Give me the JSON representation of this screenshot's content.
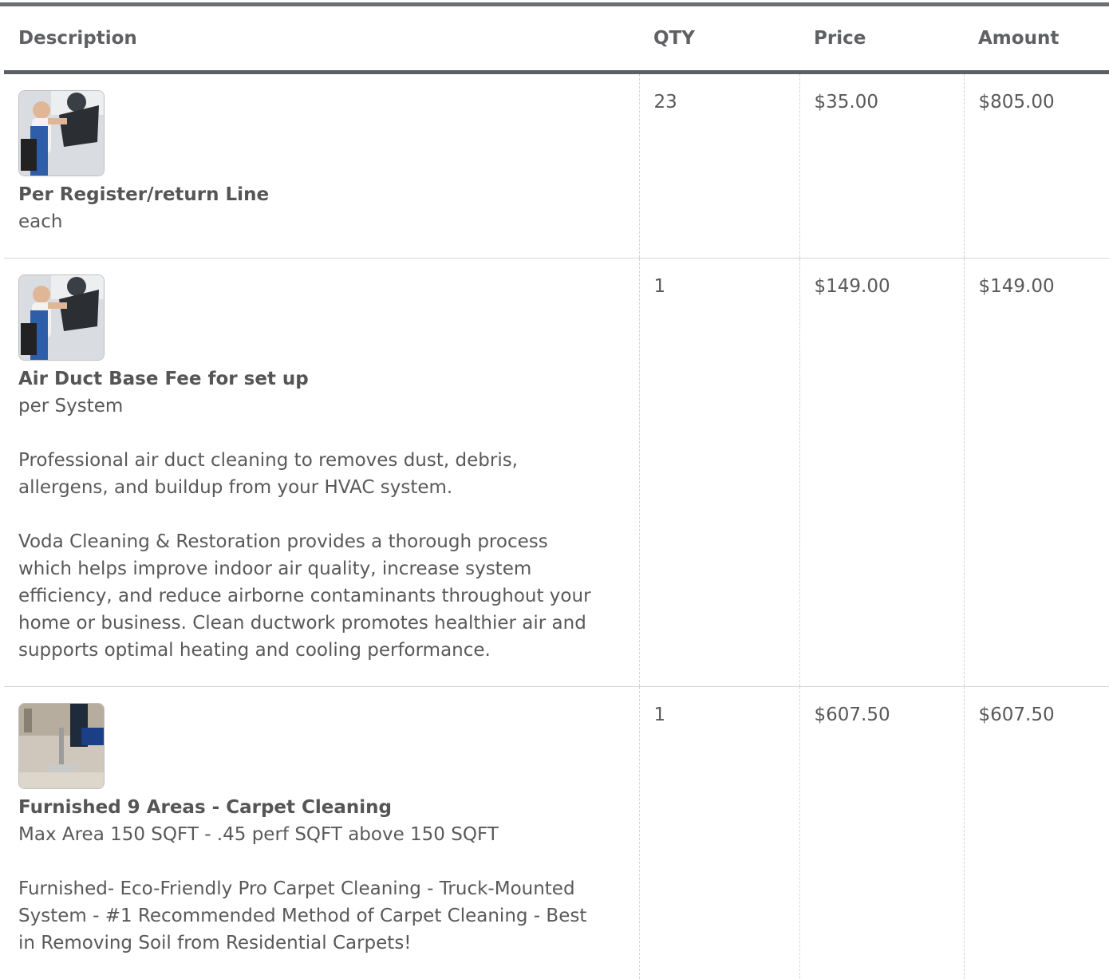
{
  "table": {
    "headers": {
      "description": "Description",
      "qty": "QTY",
      "price": "Price",
      "amount": "Amount"
    },
    "rows": [
      {
        "thumbnail": "hvac-technician-photo",
        "name": "Per Register/return Line",
        "unit": "each",
        "description": "",
        "qty": "23",
        "price": "$35.00",
        "amount": "$805.00"
      },
      {
        "thumbnail": "hvac-technician-photo",
        "name": "Air Duct Base Fee for set up",
        "unit": "per System",
        "description": "Professional air duct cleaning to removes dust, debris, allergens, and buildup from your HVAC system.\n\nVoda Cleaning & Restoration provides a thorough process which helps improve indoor air quality, increase system efficiency, and reduce airborne contaminants throughout your home or business. Clean ductwork promotes healthier air and supports optimal heating and cooling performance.",
        "qty": "1",
        "price": "$149.00",
        "amount": "$149.00"
      },
      {
        "thumbnail": "carpet-cleaning-photo",
        "name": "Furnished 9 Areas - Carpet Cleaning",
        "unit": "Max Area 150 SQFT - .45 perf SQFT above 150 SQFT",
        "description": "Furnished- Eco-Friendly Pro Carpet Cleaning - Truck-Mounted System - #1 Recommended Method of Carpet Cleaning - Best in Removing Soil from Residential Carpets!",
        "qty": "1",
        "price": "$607.50",
        "amount": "$607.50"
      }
    ]
  },
  "colors": {
    "header_rule": "#5b5e62",
    "text": "#595959",
    "row_divider": "#d6d6d6"
  }
}
